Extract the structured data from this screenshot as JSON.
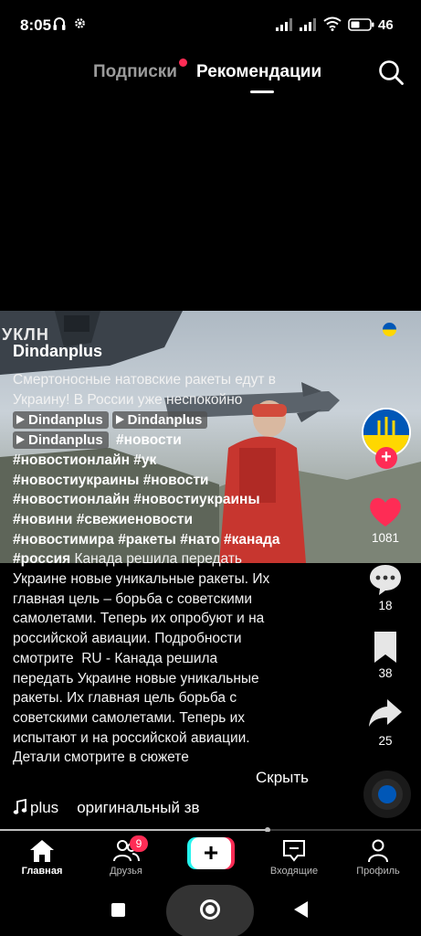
{
  "status_bar": {
    "time": "8:05",
    "battery": "46"
  },
  "top_tabs": {
    "following": "Подписки",
    "for_you": "Рекомендации"
  },
  "post": {
    "author": "Dindanplus",
    "caption_text": "Смертоносные натовские ракеты едут в Украину! В России уже неспокойно",
    "linked_chips": [
      "Dindanplus",
      "Dindanplus",
      "Dindanplus"
    ],
    "hashtags": [
      "#новости",
      "#новостионлайн",
      "#ук",
      "#новостиукраины",
      "#новости",
      "#новостионлайн",
      "#новостиукраины",
      "#новини",
      "#свежиеновости",
      "#новостимира",
      "#ракеты",
      "#нато",
      "#канада",
      "#россия"
    ],
    "description_lines": [
      "Канада решила передать",
      "Украине новые уникальные ракеты. Их",
      "главная цель – борьба с советскими",
      "самолетами. Теперь их опробуют и на",
      "российской авиации. Подробности",
      "смотрите  RU - Канада решила",
      "передать Украине новые уникальные",
      "ракеты. Их главная цель борьба с",
      "советскими самолетами. Теперь их",
      "испытают и на российской авиации.",
      "Детали смотрите в сюжете"
    ],
    "hide_label": "Скрыть",
    "music_author": "plus",
    "music_title": "оригинальный зв",
    "video_overlay_text": "УКЛН"
  },
  "actions": {
    "likes": "1081",
    "comments": "18",
    "saves": "38",
    "shares": "25"
  },
  "progress_fraction": 0.635,
  "bottom_nav": {
    "home": "Главная",
    "friends": "Друзья",
    "friends_badge": "9",
    "create": "+",
    "inbox": "Входящие",
    "profile": "Профиль"
  },
  "colors": {
    "accent": "#fe2c55",
    "cyan": "#25f4ee",
    "background": "#000000"
  }
}
